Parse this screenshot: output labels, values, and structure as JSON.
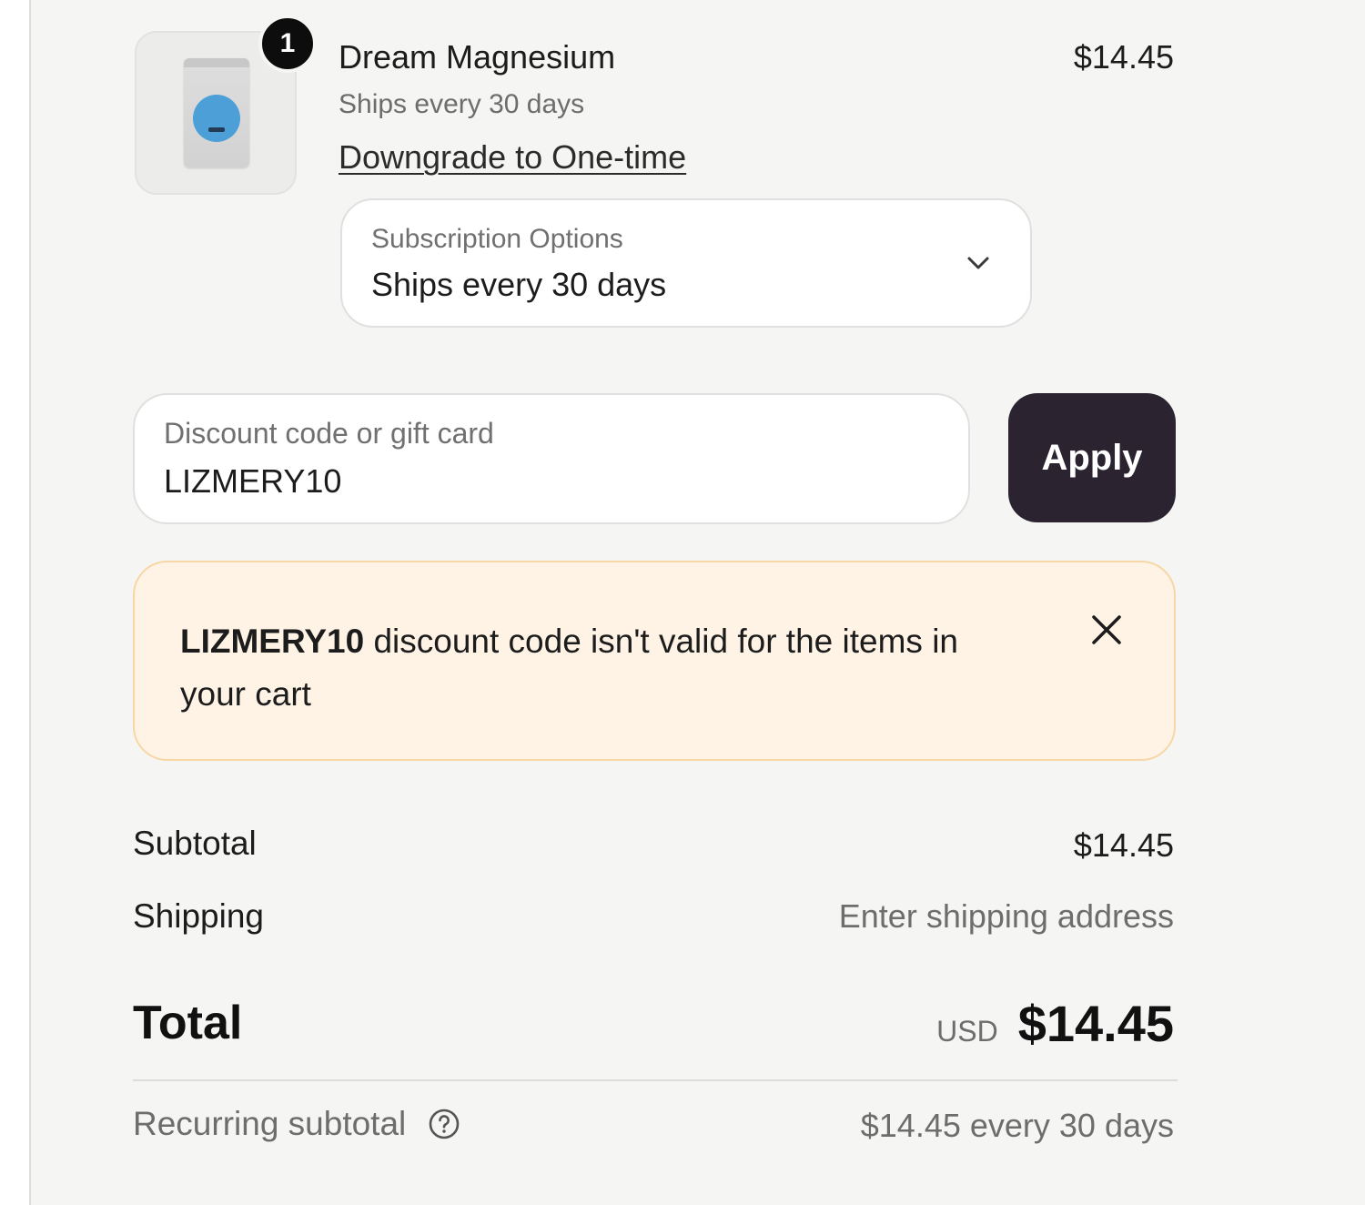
{
  "line_item": {
    "quantity": "1",
    "name": "Dream Magnesium",
    "frequency": "Ships every 30 days",
    "downgrade_link": "Downgrade to One-time",
    "price": "$14.45",
    "image_icon": "product-pouch-icon"
  },
  "subscription_select": {
    "label": "Subscription Options",
    "selected": "Ships every 30 days",
    "icon": "chevron-down-icon"
  },
  "discount": {
    "label": "Discount code or gift card",
    "value": "LIZMERY10",
    "apply_label": "Apply"
  },
  "warning": {
    "code": "LIZMERY10",
    "message": " discount code isn't valid for the items in your cart",
    "close_icon": "close-icon"
  },
  "summary": {
    "subtotal_label": "Subtotal",
    "subtotal_value": "$14.45",
    "shipping_label": "Shipping",
    "shipping_value": "Enter shipping address",
    "total_label": "Total",
    "total_currency": "USD",
    "total_value": "$14.45",
    "recurring_label": "Recurring subtotal",
    "recurring_value": "$14.45 every 30 days",
    "help_icon": "help-circle-icon"
  },
  "colors": {
    "panel_bg": "#f5f5f3",
    "apply_button": "#2c2331",
    "warning_bg": "#fff3e6",
    "warning_border": "#f7d7a6",
    "muted_text": "#6d6d6d"
  }
}
